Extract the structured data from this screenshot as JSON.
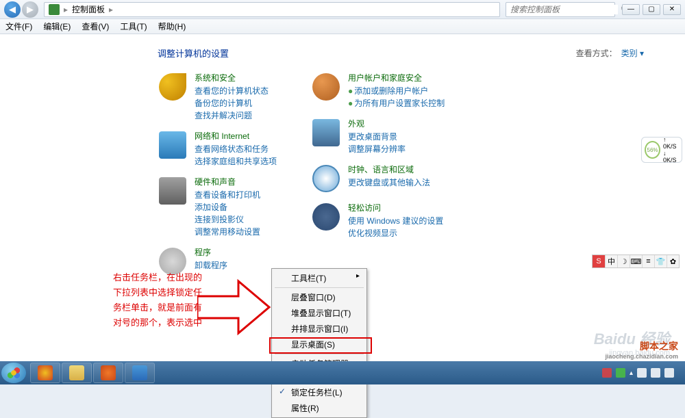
{
  "titlebar": {
    "breadcrumb_root": "控制面板",
    "search_placeholder": "搜索控制面板"
  },
  "window_controls": {
    "min": "—",
    "max": "▢",
    "close": "✕"
  },
  "menubar": [
    "文件(F)",
    "编辑(E)",
    "查看(V)",
    "工具(T)",
    "帮助(H)"
  ],
  "content": {
    "heading": "调整计算机的设置",
    "view_label": "查看方式：",
    "view_value": "类别"
  },
  "categories_left": [
    {
      "title": "系统和安全",
      "links": [
        "查看您的计算机状态",
        "备份您的计算机",
        "查找并解决问题"
      ]
    },
    {
      "title": "网络和 Internet",
      "links": [
        "查看网络状态和任务",
        "选择家庭组和共享选项"
      ]
    },
    {
      "title": "硬件和声音",
      "links": [
        "查看设备和打印机",
        "添加设备",
        "连接到投影仪",
        "调整常用移动设置"
      ]
    },
    {
      "title": "程序",
      "links": [
        "卸载程序"
      ]
    }
  ],
  "categories_right": [
    {
      "title": "用户帐户和家庭安全",
      "links": [
        "添加或删除用户帐户",
        "为所有用户设置家长控制"
      ],
      "bullet": true
    },
    {
      "title": "外观",
      "links": [
        "更改桌面背景",
        "调整屏幕分辨率"
      ]
    },
    {
      "title": "时钟、语言和区域",
      "links": [
        "更改键盘或其他输入法"
      ]
    },
    {
      "title": "轻松访问",
      "links": [
        "使用 Windows 建议的设置",
        "优化视频显示"
      ]
    }
  ],
  "annotation": "右击任务栏，在出现的下拉列表中选择锁定任务栏单击，就是前面有对号的那个，表示选中",
  "context_menu": {
    "items": [
      {
        "label": "工具栏(T)",
        "sub": true
      },
      {
        "label": "层叠窗口(D)"
      },
      {
        "label": "堆叠显示窗口(T)"
      },
      {
        "label": "并排显示窗口(I)"
      },
      {
        "label": "显示桌面(S)"
      },
      {
        "label": "启动任务管理器(K)"
      },
      {
        "label": "锁定任务栏(L)",
        "check": true
      },
      {
        "label": "属性(R)"
      }
    ]
  },
  "perf": {
    "pct": "56%",
    "up": "↑  0K/S",
    "down": "↓  0K/S"
  },
  "ime": [
    "S",
    "中",
    "☽",
    "⌨",
    "≡",
    "👕",
    "✿"
  ],
  "taskbar_time": {
    "time": "",
    "date": ""
  },
  "watermark": {
    "brand": "Baidu",
    "sub": "经验",
    "url": "jingyan.baidu.com"
  },
  "watermark2": {
    "name": "脚本之家",
    "url": "jiaocheng.chazidian.com"
  }
}
